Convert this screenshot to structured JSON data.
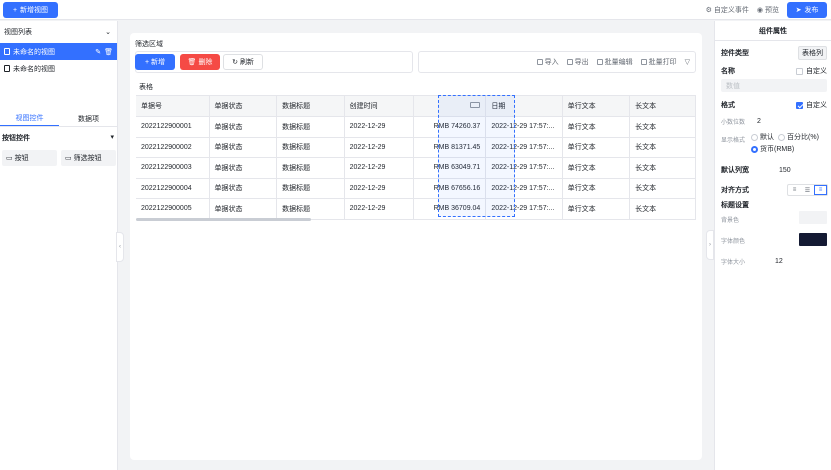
{
  "topbar": {
    "new_view": "新增视图",
    "custom_event": "自定义事件",
    "preview": "预览",
    "publish": "发布"
  },
  "left": {
    "title": "视图列表",
    "views": [
      "未命名的视图",
      "未命名的视图"
    ],
    "tabs": [
      "视图控件",
      "数据项"
    ],
    "group": "按钮控件",
    "chips": [
      "按钮",
      "筛选按钮"
    ]
  },
  "canvas": {
    "filter_label": "筛选区域",
    "btn_add": "新增",
    "btn_delete": "删除",
    "btn_refresh": "刷新",
    "tools": [
      "导入",
      "导出",
      "批量编辑",
      "批量打印"
    ],
    "table_label": "表格"
  },
  "table": {
    "columns": [
      "单据号",
      "单据状态",
      "数据标题",
      "创建时间",
      "",
      "日期",
      "单行文本",
      "长文本"
    ],
    "rows": [
      [
        "2022122900001",
        "单据状态",
        "数据标题",
        "2022-12-29",
        "RMB 74260.37",
        "2022-12-29 17:57:...",
        "单行文本",
        "长文本"
      ],
      [
        "2022122900002",
        "单据状态",
        "数据标题",
        "2022-12-29",
        "RMB 81371.45",
        "2022-12-29 17:57:...",
        "单行文本",
        "长文本"
      ],
      [
        "2022122900003",
        "单据状态",
        "数据标题",
        "2022-12-29",
        "RMB 63049.71",
        "2022-12-29 17:57:...",
        "单行文本",
        "长文本"
      ],
      [
        "2022122900004",
        "单据状态",
        "数据标题",
        "2022-12-29",
        "RMB 67656.16",
        "2022-12-29 17:57:...",
        "单行文本",
        "长文本"
      ],
      [
        "2022122900005",
        "单据状态",
        "数据标题",
        "2022-12-29",
        "RMB 36709.04",
        "2022-12-29 17:57:...",
        "单行文本",
        "长文本"
      ]
    ]
  },
  "props": {
    "title": "组件属性",
    "type_label": "控件类型",
    "type_value": "表格列",
    "name_label": "名称",
    "custom": "自定义",
    "name_placeholder": "数值",
    "format_label": "格式",
    "decimal_label": "小数位数",
    "decimal_value": "2",
    "display_label": "显示格式",
    "opt_default": "默认",
    "opt_percent": "百分比(%)",
    "opt_currency": "货币(RMB)",
    "width_label": "默认列宽",
    "width_value": "150",
    "align_label": "对齐方式",
    "title_settings": "标题设置",
    "bg_label": "背景色",
    "font_color_label": "字体颜色",
    "font_size_label": "字体大小",
    "font_size_value": "12",
    "bg_color": "#f2f3f5",
    "font_color": "#141a33"
  },
  "colors": {
    "primary": "#3370ff",
    "danger": "#f54a45"
  }
}
